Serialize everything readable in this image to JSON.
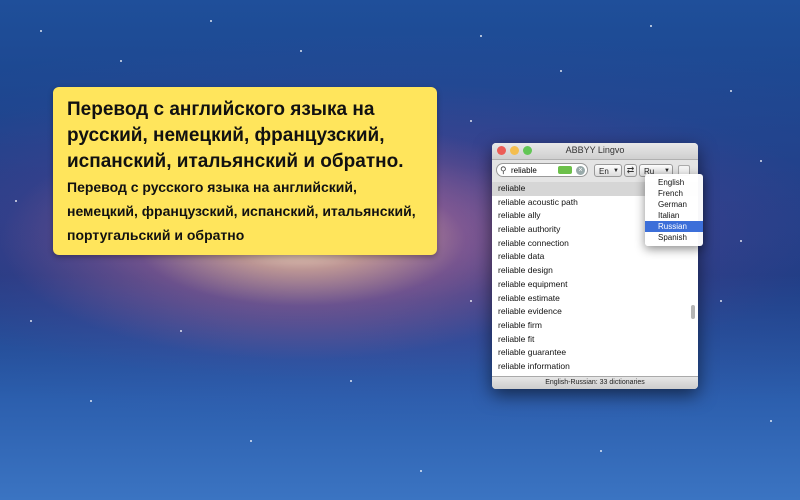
{
  "promo": {
    "headline": "Перевод с английского языка на русский, немецкий, французский, испанский, итальянский и обратно.",
    "subline": "Перевод с русского языка на английский, немецкий, французский, испанский, итальянский, португальский и обратно"
  },
  "window": {
    "title": "ABBYY Lingvo",
    "search": {
      "value": "reliable",
      "icon": "search-icon"
    },
    "source_lang": "En",
    "target_lang": "Ru",
    "status": "English-Russian: 33 dictionaries"
  },
  "results": [
    "reliable",
    "reliable acoustic path",
    "reliable ally",
    "reliable authority",
    "reliable connection",
    "reliable data",
    "reliable design",
    "reliable equipment",
    "reliable estimate",
    "reliable evidence",
    "reliable firm",
    "reliable fit",
    "reliable guarantee",
    "reliable information"
  ],
  "language_menu": [
    "English",
    "French",
    "German",
    "Italian",
    "Russian",
    "Spanish"
  ],
  "selected_language": "Russian",
  "colors": {
    "promo_bg": "#ffe55c",
    "selection": "#3c6fd9"
  }
}
